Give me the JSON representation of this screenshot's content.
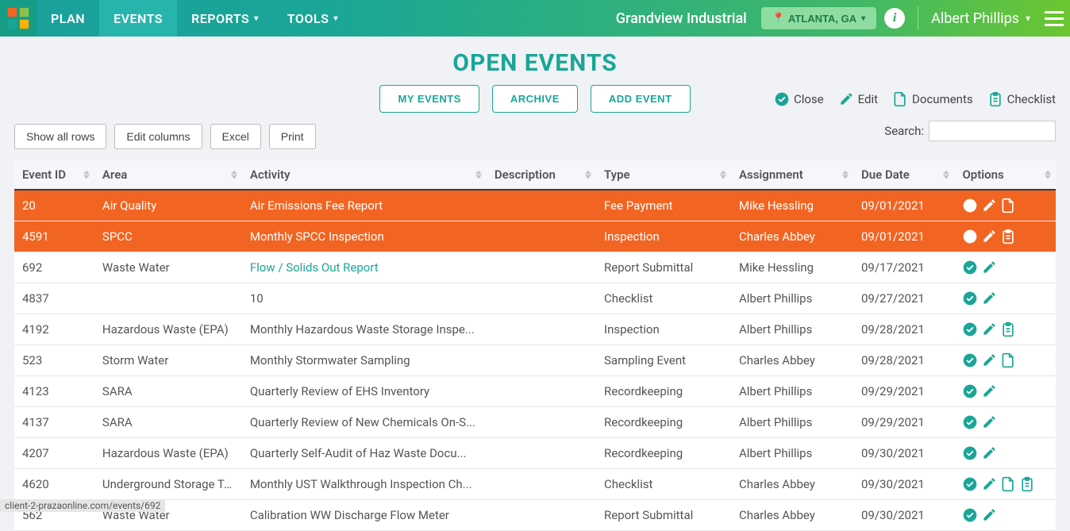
{
  "nav": {
    "plan": "PLAN",
    "events": "EVENTS",
    "reports": "REPORTS",
    "tools": "TOOLS",
    "company": "Grandview Industrial",
    "location": "ATLANTA, GA",
    "user": "Albert Phillips"
  },
  "page_title": "OPEN EVENTS",
  "subtabs": {
    "my_events": "MY EVENTS",
    "archive": "ARCHIVE",
    "add_event": "ADD EVENT"
  },
  "legend": {
    "close": "Close",
    "edit": "Edit",
    "documents": "Documents",
    "checklist": "Checklist"
  },
  "toolbar": {
    "show_all": "Show all rows",
    "edit_cols": "Edit columns",
    "excel": "Excel",
    "print": "Print"
  },
  "search_label": "Search:",
  "columns": {
    "event_id": "Event ID",
    "area": "Area",
    "activity": "Activity",
    "description": "Description",
    "type": "Type",
    "assignment": "Assignment",
    "due_date": "Due Date",
    "options": "Options"
  },
  "rows": [
    {
      "id": "20",
      "area": "Air Quality",
      "activity": "Air Emissions Fee Report",
      "desc": "",
      "type": "Fee Payment",
      "assign": "Mike Hessling",
      "due": "09/01/2021",
      "overdue": true,
      "opts": [
        "close",
        "edit",
        "doc"
      ]
    },
    {
      "id": "4591",
      "area": "SPCC",
      "activity": "Monthly SPCC Inspection",
      "desc": "",
      "type": "Inspection",
      "assign": "Charles Abbey",
      "due": "09/01/2021",
      "overdue": true,
      "opts": [
        "close",
        "edit",
        "checklist"
      ]
    },
    {
      "id": "692",
      "area": "Waste Water",
      "activity": "Flow / Solids Out Report",
      "activity_link": true,
      "desc": "",
      "type": "Report Submittal",
      "assign": "Mike Hessling",
      "due": "09/17/2021",
      "opts": [
        "close",
        "edit"
      ]
    },
    {
      "id": "4837",
      "area": "",
      "activity": "10",
      "desc": "",
      "type": "Checklist",
      "assign": "Albert Phillips",
      "due": "09/27/2021",
      "opts": [
        "close",
        "edit"
      ]
    },
    {
      "id": "4192",
      "area": "Hazardous Waste (EPA)",
      "activity": "Monthly Hazardous Waste Storage Inspe...",
      "desc": "",
      "type": "Inspection",
      "assign": "Albert Phillips",
      "due": "09/28/2021",
      "opts": [
        "close",
        "edit",
        "checklist"
      ]
    },
    {
      "id": "523",
      "area": "Storm Water",
      "activity": "Monthly Stormwater Sampling",
      "desc": "",
      "type": "Sampling Event",
      "assign": "Charles Abbey",
      "due": "09/28/2021",
      "opts": [
        "close",
        "edit",
        "doc"
      ]
    },
    {
      "id": "4123",
      "area": "SARA",
      "activity": "Quarterly Review of EHS Inventory",
      "desc": "",
      "type": "Recordkeeping",
      "assign": "Albert Phillips",
      "due": "09/29/2021",
      "opts": [
        "close",
        "edit"
      ]
    },
    {
      "id": "4137",
      "area": "SARA",
      "activity": "Quarterly Review of New Chemicals On-S...",
      "desc": "",
      "type": "Recordkeeping",
      "assign": "Albert Phillips",
      "due": "09/29/2021",
      "opts": [
        "close",
        "edit"
      ]
    },
    {
      "id": "4207",
      "area": "Hazardous Waste (EPA)",
      "activity": "Quarterly Self-Audit of Haz Waste Docu...",
      "desc": "",
      "type": "Recordkeeping",
      "assign": "Albert Phillips",
      "due": "09/30/2021",
      "opts": [
        "close",
        "edit"
      ]
    },
    {
      "id": "4620",
      "area": "Underground Storage Ta...",
      "activity": "Monthly UST Walkthrough Inspection Ch...",
      "desc": "",
      "type": "Checklist",
      "assign": "Charles Abbey",
      "due": "09/30/2021",
      "opts": [
        "close",
        "edit",
        "doc",
        "checklist"
      ]
    },
    {
      "id": "562",
      "area": "Waste Water",
      "activity": "Calibration WW Discharge Flow Meter",
      "desc": "",
      "type": "Report Submittal",
      "assign": "Charles Abbey",
      "due": "09/30/2021",
      "opts": [
        "close",
        "edit"
      ]
    }
  ],
  "status_url": "client-2-prazaonline.com/events/692",
  "colors": {
    "teal": "#1aa697",
    "overdue": "#f26421"
  }
}
